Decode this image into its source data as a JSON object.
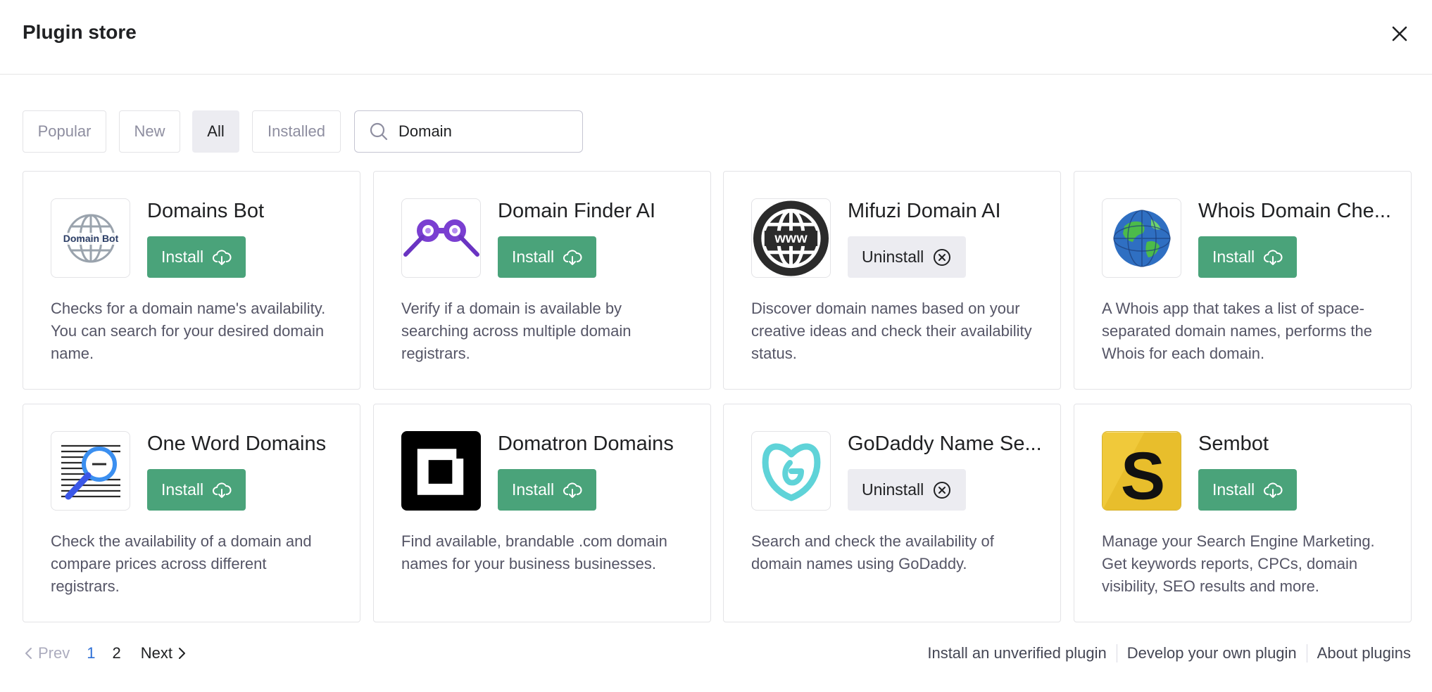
{
  "modal": {
    "title": "Plugin store"
  },
  "filters": {
    "tabs": [
      {
        "label": "Popular"
      },
      {
        "label": "New"
      },
      {
        "label": "All"
      },
      {
        "label": "Installed"
      }
    ],
    "active_tab": "All",
    "search": {
      "value": "Domain",
      "placeholder": "Search plugins"
    }
  },
  "plugins": [
    {
      "name": "Domains Bot",
      "action": "Install",
      "description": "Checks for a domain name's availability. You can search for your desired domain name.",
      "logo_text": "Domain Bot",
      "icon": "globe-domain-bot-icon"
    },
    {
      "name": "Domain Finder AI",
      "action": "Install",
      "description": "Verify if a domain is available by searching across multiple domain registrars.",
      "icon": "binoculars-icon"
    },
    {
      "name": "Mifuzi Domain AI",
      "action": "Uninstall",
      "description": "Discover domain names based on your creative ideas and check their availability status.",
      "logo_text": "www",
      "icon": "www-globe-icon"
    },
    {
      "name": "Whois Domain Che...",
      "action": "Install",
      "description": "A Whois app that takes a list of space-separated domain names, performs the Whois for each domain.",
      "icon": "earth-globe-icon"
    },
    {
      "name": "One Word Domains",
      "action": "Install",
      "description": "Check the availability of a domain and compare prices across different registrars.",
      "icon": "magnifier-document-icon"
    },
    {
      "name": "Domatron Domains",
      "action": "Install",
      "description": "Find available, brandable .com domain names for your business businesses.",
      "icon": "square-frame-icon"
    },
    {
      "name": "GoDaddy Name Se...",
      "action": "Uninstall",
      "description": "Search and check the availability of domain names using GoDaddy.",
      "icon": "godaddy-g-icon"
    },
    {
      "name": "Sembot",
      "action": "Install",
      "description": "Manage your Search Engine Marketing. Get keywords reports, CPCs, domain visibility, SEO results and more.",
      "logo_text": "S",
      "icon": "sembot-s-icon"
    }
  ],
  "pagination": {
    "prev": "Prev",
    "pages": [
      "1",
      "2"
    ],
    "current": "1",
    "next": "Next"
  },
  "footer_links": [
    "Install an unverified plugin",
    "Develop your own plugin",
    "About plugins"
  ],
  "colors": {
    "install": "#4aa37a",
    "uninstall": "#ececf1",
    "current_page": "#2d6fd6"
  }
}
